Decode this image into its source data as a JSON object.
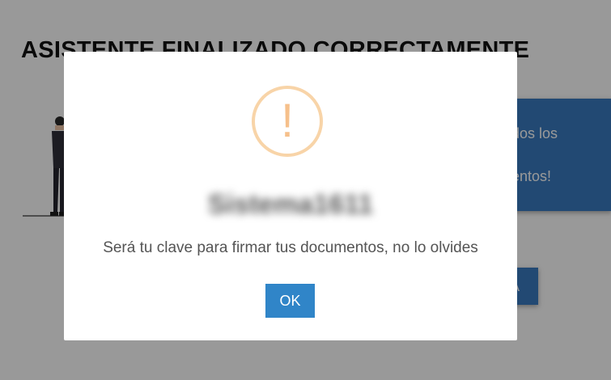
{
  "page": {
    "title": "ASISTENTE FINALIZADO CORRECTAMENTE"
  },
  "info_card": {
    "line1": "dos los",
    "line2": "entos!"
  },
  "background_button": {
    "label": "A"
  },
  "modal": {
    "icon": "warning-icon",
    "icon_glyph": "!",
    "title": "Sistema1611",
    "message": "Será tu clave para firmar tus documentos, no lo olvides",
    "ok_label": "OK"
  },
  "colors": {
    "overlay": "rgba(0,0,0,0.4)",
    "accent_blue": "#3085c8",
    "warning_orange": "#f6c08b",
    "card_blue": "#3a7bc0"
  }
}
